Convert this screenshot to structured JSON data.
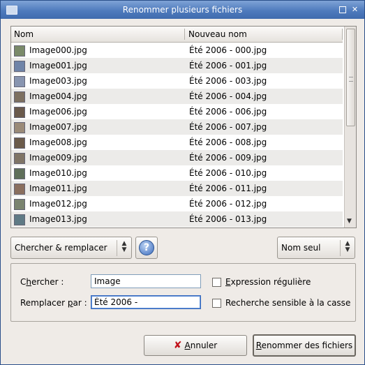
{
  "window": {
    "title": "Renommer plusieurs fichiers"
  },
  "icons": {
    "window": "folder-icon",
    "maximize": "maximize-icon",
    "close": "close-icon",
    "help": "help-icon",
    "cancel": "cancel-x-icon"
  },
  "colors": {
    "titlebar": "#4f7bbd",
    "cancel_icon": "#c1121b",
    "help_icon": "#3a6bbd"
  },
  "table": {
    "headers": [
      "Nom",
      "Nouveau nom"
    ],
    "rows": [
      {
        "name": "Image000.jpg",
        "new_name": "Été 2006 - 000.jpg"
      },
      {
        "name": "Image001.jpg",
        "new_name": "Été 2006 - 001.jpg"
      },
      {
        "name": "Image003.jpg",
        "new_name": "Été 2006 - 003.jpg"
      },
      {
        "name": "Image004.jpg",
        "new_name": "Été 2006 - 004.jpg"
      },
      {
        "name": "Image006.jpg",
        "new_name": "Été 2006 - 006.jpg"
      },
      {
        "name": "Image007.jpg",
        "new_name": "Été 2006 - 007.jpg"
      },
      {
        "name": "Image008.jpg",
        "new_name": "Été 2006 - 008.jpg"
      },
      {
        "name": "Image009.jpg",
        "new_name": "Été 2006 - 009.jpg"
      },
      {
        "name": "Image010.jpg",
        "new_name": "Été 2006 - 010.jpg"
      },
      {
        "name": "Image011.jpg",
        "new_name": "Été 2006 - 011.jpg"
      },
      {
        "name": "Image012.jpg",
        "new_name": "Été 2006 - 012.jpg"
      },
      {
        "name": "Image013.jpg",
        "new_name": "Été 2006 - 013.jpg"
      }
    ]
  },
  "mode_combo": {
    "value": "Chercher & remplacer"
  },
  "scope_combo": {
    "value": "Nom seul"
  },
  "search": {
    "label_prefix": "C",
    "label_accel": "h",
    "label_rest": "ercher :",
    "value": "Image"
  },
  "replace": {
    "label_prefix": "Remplacer ",
    "label_accel": "p",
    "label_rest": "ar :",
    "value": "Été 2006 - "
  },
  "options": {
    "regex": {
      "accel": "E",
      "rest": "xpression régulière",
      "checked": false
    },
    "case": {
      "label": "Recherche sensible à la casse",
      "checked": false
    }
  },
  "buttons": {
    "cancel": {
      "accel": "A",
      "rest": "nnuler"
    },
    "rename": {
      "accel": "R",
      "rest": "enommer des fichiers"
    }
  }
}
